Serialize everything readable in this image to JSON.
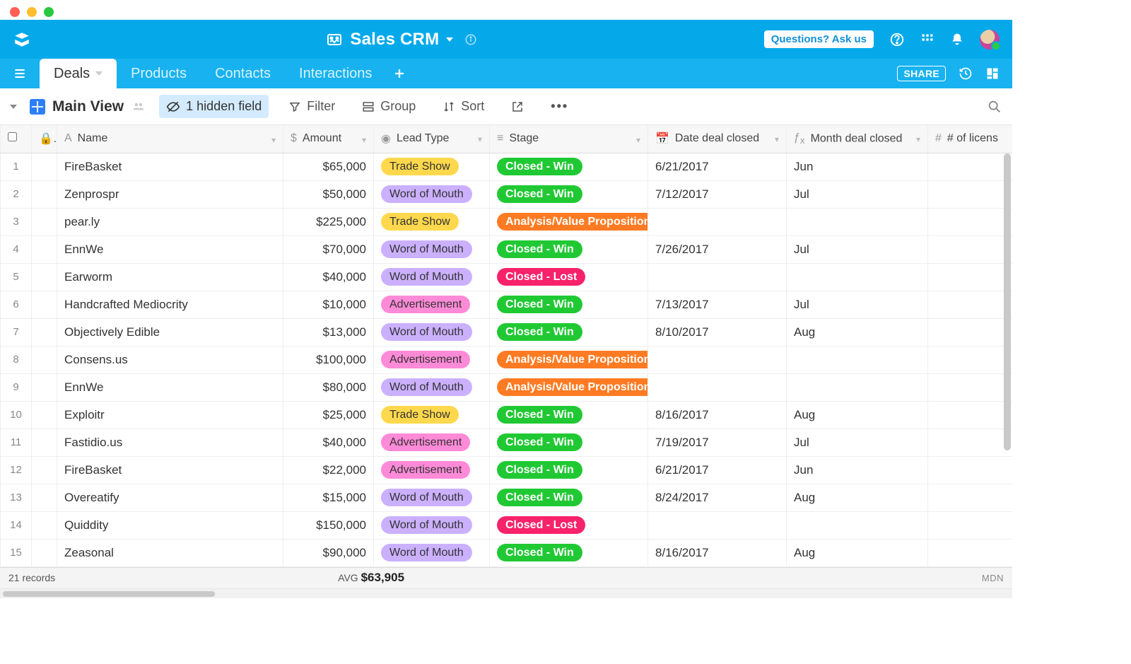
{
  "app": {
    "base_name": "Sales CRM",
    "ask_label": "Questions? Ask us",
    "share_label": "SHARE"
  },
  "tabs": [
    {
      "label": "Deals",
      "active": true
    },
    {
      "label": "Products",
      "active": false
    },
    {
      "label": "Contacts",
      "active": false
    },
    {
      "label": "Interactions",
      "active": false
    }
  ],
  "view": {
    "name": "Main View",
    "hidden_fields_label": "1 hidden field",
    "filter_label": "Filter",
    "group_label": "Group",
    "sort_label": "Sort"
  },
  "columns": {
    "name": "Name",
    "amount": "Amount",
    "lead_type": "Lead Type",
    "stage": "Stage",
    "date_closed": "Date deal closed",
    "month_closed": "Month deal closed",
    "licenses": "# of licens"
  },
  "rows": [
    {
      "n": 1,
      "name": "FireBasket",
      "amount": "$65,000",
      "lead": "Trade Show",
      "stage": "Closed - Win",
      "date": "6/21/2017",
      "month": "Jun"
    },
    {
      "n": 2,
      "name": "Zenprospr",
      "amount": "$50,000",
      "lead": "Word of Mouth",
      "stage": "Closed - Win",
      "date": "7/12/2017",
      "month": "Jul"
    },
    {
      "n": 3,
      "name": "pear.ly",
      "amount": "$225,000",
      "lead": "Trade Show",
      "stage": "Analysis/Value Proposition",
      "date": "",
      "month": ""
    },
    {
      "n": 4,
      "name": "EnnWe",
      "amount": "$70,000",
      "lead": "Word of Mouth",
      "stage": "Closed - Win",
      "date": "7/26/2017",
      "month": "Jul"
    },
    {
      "n": 5,
      "name": "Earworm",
      "amount": "$40,000",
      "lead": "Word of Mouth",
      "stage": "Closed - Lost",
      "date": "",
      "month": ""
    },
    {
      "n": 6,
      "name": "Handcrafted Mediocrity",
      "amount": "$10,000",
      "lead": "Advertisement",
      "stage": "Closed - Win",
      "date": "7/13/2017",
      "month": "Jul"
    },
    {
      "n": 7,
      "name": "Objectively Edible",
      "amount": "$13,000",
      "lead": "Word of Mouth",
      "stage": "Closed - Win",
      "date": "8/10/2017",
      "month": "Aug"
    },
    {
      "n": 8,
      "name": "Consens.us",
      "amount": "$100,000",
      "lead": "Advertisement",
      "stage": "Analysis/Value Proposition",
      "date": "",
      "month": ""
    },
    {
      "n": 9,
      "name": "EnnWe",
      "amount": "$80,000",
      "lead": "Word of Mouth",
      "stage": "Analysis/Value Proposition",
      "date": "",
      "month": ""
    },
    {
      "n": 10,
      "name": "Exploitr",
      "amount": "$25,000",
      "lead": "Trade Show",
      "stage": "Closed - Win",
      "date": "8/16/2017",
      "month": "Aug"
    },
    {
      "n": 11,
      "name": "Fastidio.us",
      "amount": "$40,000",
      "lead": "Advertisement",
      "stage": "Closed - Win",
      "date": "7/19/2017",
      "month": "Jul"
    },
    {
      "n": 12,
      "name": "FireBasket",
      "amount": "$22,000",
      "lead": "Advertisement",
      "stage": "Closed - Win",
      "date": "6/21/2017",
      "month": "Jun"
    },
    {
      "n": 13,
      "name": "Overeatify",
      "amount": "$15,000",
      "lead": "Word of Mouth",
      "stage": "Closed - Win",
      "date": "8/24/2017",
      "month": "Aug"
    },
    {
      "n": 14,
      "name": "Quiddity",
      "amount": "$150,000",
      "lead": "Word of Mouth",
      "stage": "Closed - Lost",
      "date": "",
      "month": ""
    },
    {
      "n": 15,
      "name": "Zeasonal",
      "amount": "$90,000",
      "lead": "Word of Mouth",
      "stage": "Closed - Win",
      "date": "8/16/2017",
      "month": "Aug"
    }
  ],
  "footer": {
    "record_count": "21 records",
    "avg_label": "AVG",
    "avg_value": "$63,905",
    "right": "MDN"
  },
  "leadClass": {
    "Trade Show": "pill-trade",
    "Word of Mouth": "pill-word",
    "Advertisement": "pill-ad"
  },
  "stageClass": {
    "Closed - Win": "pill-win",
    "Closed - Lost": "pill-lost",
    "Analysis/Value Proposition": "pill-avp"
  }
}
